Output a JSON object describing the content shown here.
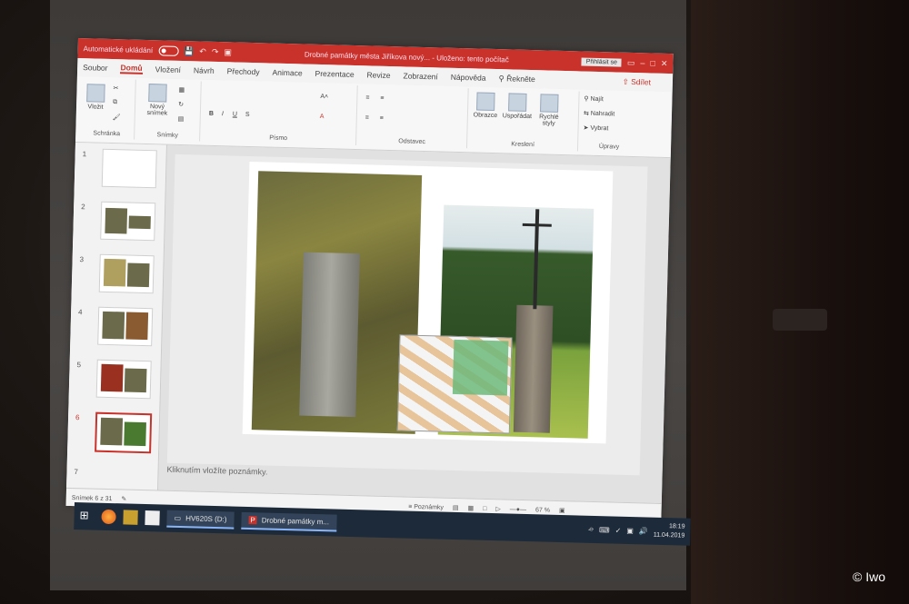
{
  "titlebar": {
    "autosave": "Automatické ukládání",
    "title": "Drobné památky města Jiříkova nový...",
    "saved": "Uloženo: tento počítač",
    "signin": "Přihlásit se"
  },
  "tabs": [
    "Soubor",
    "Domů",
    "Vložení",
    "Návrh",
    "Přechody",
    "Animace",
    "Prezentace",
    "Revize",
    "Zobrazení",
    "Nápověda"
  ],
  "tell_me": "Řekněte",
  "share": "Sdílet",
  "ribbon": {
    "clipboard_label": "Schránka",
    "paste": "Vložit",
    "new_slide": "Nový snímek",
    "slides_label": "Snímky",
    "font_label": "Písmo",
    "paragraph_label": "Odstavec",
    "shapes": "Obrazce",
    "arrange": "Uspořádat",
    "quick_styles": "Rychlé styly",
    "drawing_label": "Kreslení",
    "find": "Najít",
    "replace": "Nahradit",
    "select": "Vybrat",
    "editing_label": "Úpravy"
  },
  "thumbnails": [
    "1",
    "2",
    "3",
    "4",
    "5",
    "6",
    "7"
  ],
  "active_slide": "6",
  "notes_placeholder": "Kliknutím vložíte poznámky.",
  "status": {
    "slide_count": "Snímek 6 z 31",
    "notes": "Poznámky",
    "zoom": "67 %"
  },
  "taskbar": {
    "drive": "HV620S (D:)",
    "ppt_window": "Drobné památky m...",
    "time": "18:19",
    "date": "11.04.2019"
  },
  "copyright": "© Iwo"
}
